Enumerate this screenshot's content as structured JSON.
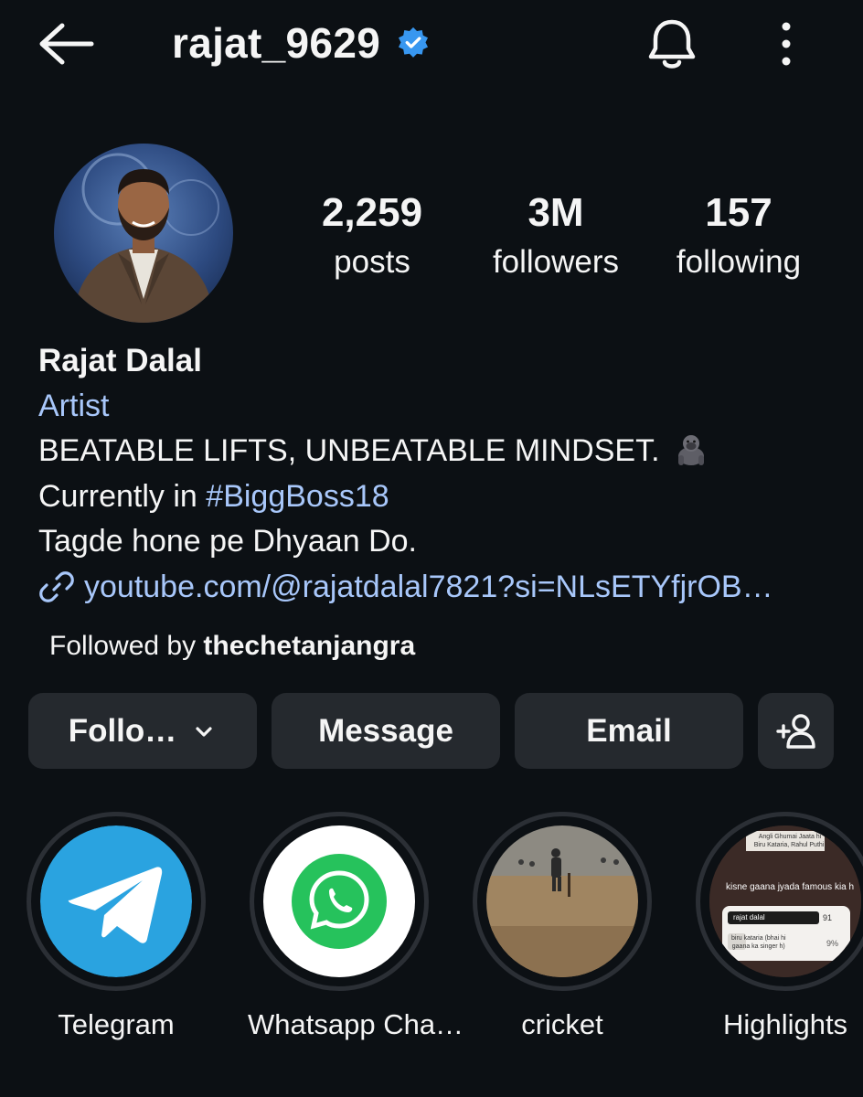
{
  "header": {
    "username": "rajat_9629",
    "verified_icon": "verified-badge-icon",
    "verified_color": "#3897f0"
  },
  "stats": {
    "posts": {
      "value": "2,259",
      "label": "posts"
    },
    "followers": {
      "value": "3M",
      "label": "followers"
    },
    "following": {
      "value": "157",
      "label": "following"
    }
  },
  "bio": {
    "name": "Rajat Dalal",
    "category": "Artist",
    "line1": "BEATABLE LIFTS, UNBEATABLE MINDSET.",
    "line1_emoji": "gorilla-emoji",
    "line2_prefix": "Currently in ",
    "line2_hashtag": "#BiggBoss18",
    "line3": "Tagde hone pe Dhyaan Do.",
    "link": "youtube.com/@rajatdalal7821?si=NLsETYfjrOB…",
    "link_color": "#a8c7fa"
  },
  "followed_by": {
    "prefix": "Followed by ",
    "user": "thechetanjangra"
  },
  "actions": {
    "follow_label": "Follo…",
    "message_label": "Message",
    "email_label": "Email"
  },
  "highlights": [
    {
      "label": "Telegram",
      "icon": "telegram-icon"
    },
    {
      "label": "Whatsapp Cha…",
      "icon": "whatsapp-icon"
    },
    {
      "label": "cricket",
      "icon": "cricket-photo"
    },
    {
      "label": "Highlights",
      "icon": "story-screenshot",
      "thumb_text": {
        "top_line1": "Angli Ghumai Jaata hi",
        "top_line2": "Biru Kataria, Rahul Puthi,",
        "question": "kisne gaana jyada famous kia h",
        "opt1": "rajat dalal",
        "opt1_pct": "91",
        "opt2_line1": "biru kataria (bhai hi",
        "opt2_line2": "gaana ka singer h)",
        "opt2_pct": "9%"
      }
    }
  ],
  "colors": {
    "background": "#0c1014",
    "button_bg": "#25292e",
    "accent_link": "#a8c7fa"
  }
}
